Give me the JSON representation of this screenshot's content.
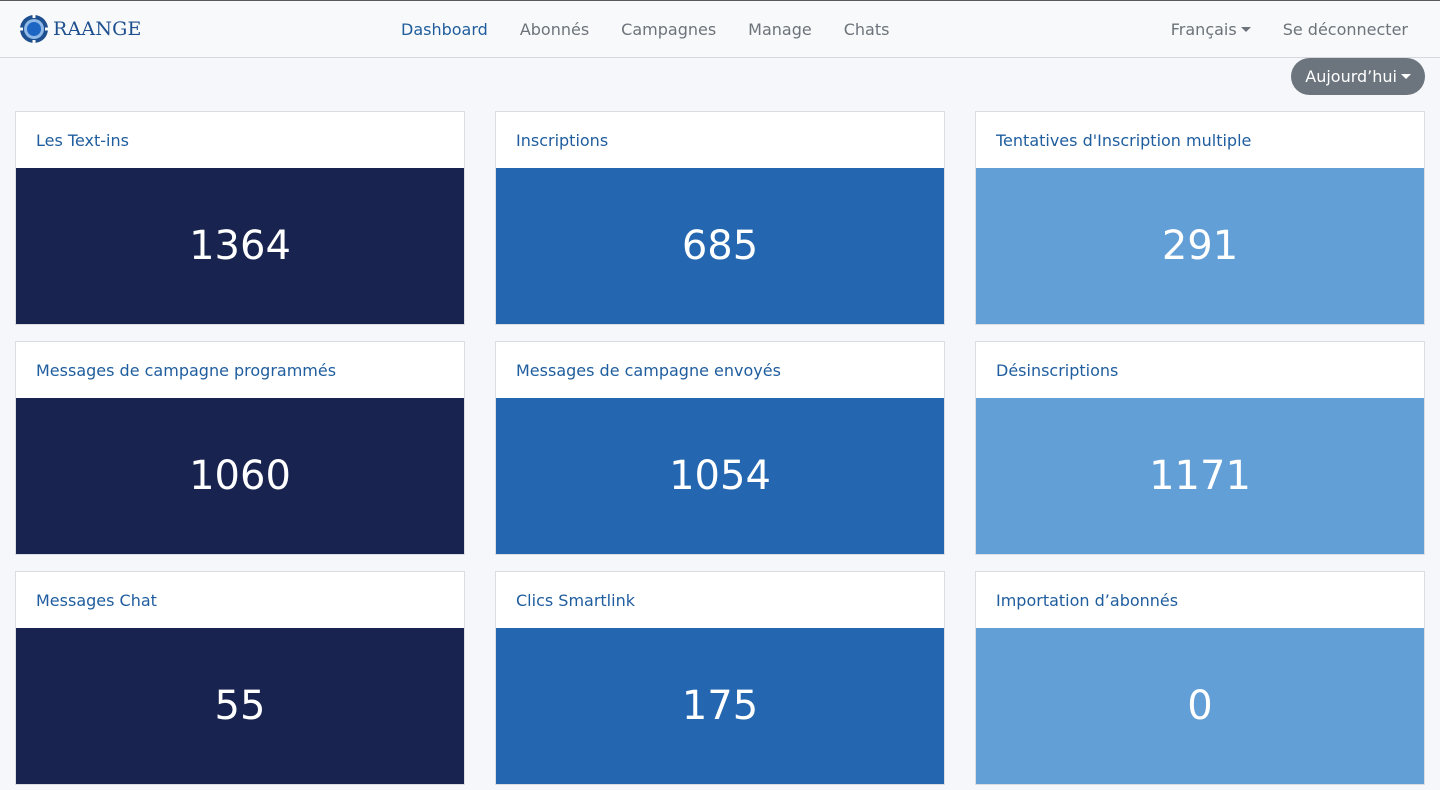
{
  "brand": {
    "name": "RAANGE"
  },
  "nav": {
    "links": [
      {
        "label": "Dashboard",
        "active": true
      },
      {
        "label": "Abonnés",
        "active": false
      },
      {
        "label": "Campagnes",
        "active": false
      },
      {
        "label": "Manage",
        "active": false
      },
      {
        "label": "Chats",
        "active": false
      }
    ],
    "language": "Français",
    "logout": "Se déconnecter"
  },
  "period": {
    "selected": "Aujourd’hui"
  },
  "stats": [
    {
      "title": "Les Text-ins",
      "value": "1364",
      "tone": "dark"
    },
    {
      "title": "Inscriptions",
      "value": "685",
      "tone": "mid"
    },
    {
      "title": "Tentatives d'Inscription multiple",
      "value": "291",
      "tone": "light"
    },
    {
      "title": "Messages de campagne programmés",
      "value": "1060",
      "tone": "dark"
    },
    {
      "title": "Messages de campagne envoyés",
      "value": "1054",
      "tone": "mid"
    },
    {
      "title": "Désinscriptions",
      "value": "1171",
      "tone": "light"
    },
    {
      "title": "Messages Chat",
      "value": "55",
      "tone": "dark"
    },
    {
      "title": "Clics Smartlink",
      "value": "175",
      "tone": "mid"
    },
    {
      "title": "Importation d’abonnés",
      "value": "0",
      "tone": "light"
    }
  ],
  "colors": {
    "dark": "#18244f",
    "mid": "#2467b0",
    "light": "#639fd7",
    "accent": "#1f5d9e"
  }
}
